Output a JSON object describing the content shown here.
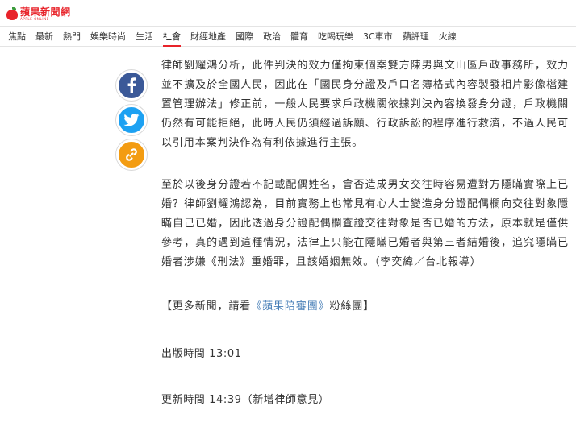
{
  "header": {
    "logo_text": "蘋果新聞網",
    "logo_subtext": "APPLE ONLINE",
    "accent_color": "#e8232a"
  },
  "nav": {
    "items": [
      {
        "label": "焦點",
        "active": false
      },
      {
        "label": "最新",
        "active": false
      },
      {
        "label": "熱門",
        "active": false
      },
      {
        "label": "娛樂時尚",
        "active": false
      },
      {
        "label": "生活",
        "active": false
      },
      {
        "label": "社會",
        "active": true
      },
      {
        "label": "財經地產",
        "active": false
      },
      {
        "label": "國際",
        "active": false
      },
      {
        "label": "政治",
        "active": false
      },
      {
        "label": "體育",
        "active": false
      },
      {
        "label": "吃喝玩樂",
        "active": false
      },
      {
        "label": "3C車市",
        "active": false
      },
      {
        "label": "蘋評理",
        "active": false
      },
      {
        "label": "火線",
        "active": false
      }
    ]
  },
  "share": {
    "facebook_icon": "facebook-icon",
    "twitter_icon": "twitter-icon",
    "link_icon": "link-icon",
    "facebook_color": "#3b5998",
    "twitter_color": "#1da1f2",
    "link_color": "#f39c12"
  },
  "article": {
    "paragraph1": "律師劉耀鴻分析，此件判決的效力僅拘束個案雙方陳男與文山區戶政事務所，效力並不擴及於全國人民，因此在「國民身分證及戶口名簿格式內容製發相片影像檔建置管理辦法」修正前，一般人民要求戶政機關依據判決內容換發身分證，戶政機關仍然有可能拒絕，此時人民仍須經過訴願、行政訴訟的程序進行救濟，不過人民可以引用本案判決作為有利依據進行主張。",
    "paragraph2": "至於以後身分證若不記載配偶姓名，會否造成男女交往時容易遭對方隱瞞實際上已婚？律師劉耀鴻認為，目前實務上也常見有心人士變造身分證配偶欄向交往對象隱瞞自己已婚，因此透過身分證配偶欄查證交往對象是否已婚的方法，原本就是僅供參考，真的遇到這種情況，法律上只能在隱瞞已婚者與第三者結婚後，追究隱瞞已婚者涉嫌《刑法》重婚罪，且該婚姻無效。（李奕緯／台北報導）",
    "more_prefix": "【更多新聞，請看",
    "more_link": "《蘋果陪審團》",
    "more_suffix": "粉絲團】",
    "published": "出版時間 13:01",
    "updated": "更新時間 14:39（新增律師意見）"
  }
}
